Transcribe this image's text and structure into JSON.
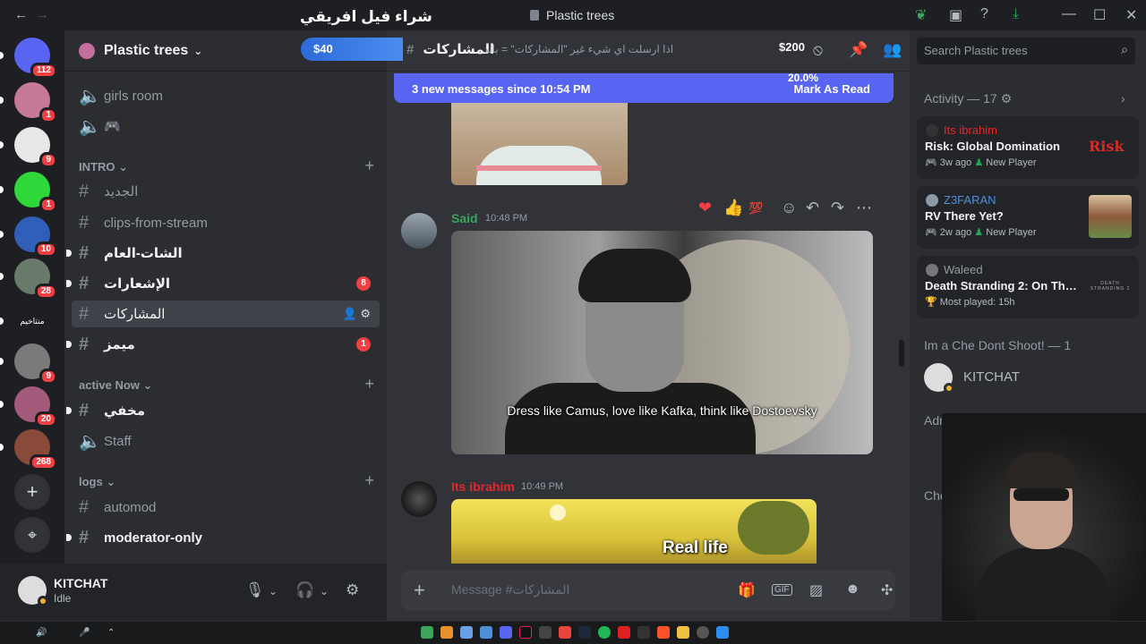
{
  "titlebar": {
    "back": "←",
    "forward": "→",
    "overlay_text": "شراء فيل افريقي",
    "window_title": "Plastic trees",
    "icons": [
      "leaf-icon",
      "screen-share-icon",
      "help-icon",
      "download-icon"
    ],
    "minimize": "—",
    "maximize": "☐",
    "close": "✕"
  },
  "servers": [
    {
      "label": "",
      "badge": "112",
      "color": "#5865f2"
    },
    {
      "label": "",
      "badge": "1",
      "color": "#c8799a"
    },
    {
      "label": "",
      "badge": "9",
      "color": "#e8e8e8"
    },
    {
      "label": "",
      "badge": "1",
      "color": "#2ed83a"
    },
    {
      "label": "",
      "badge": "10",
      "color": "#2f5fb8"
    },
    {
      "label": "",
      "badge": "28",
      "color": "#6a7a6a"
    },
    {
      "label": "منتاخيم",
      "badge": "",
      "color": "#1e1f22"
    },
    {
      "label": "",
      "badge": "9",
      "color": "#7a7a7a"
    },
    {
      "label": "",
      "badge": "20",
      "color": "#a45a7a"
    },
    {
      "label": "",
      "badge": "268",
      "color": "#8a4a3a"
    }
  ],
  "server_actions": {
    "add": "+",
    "discover": "⌖"
  },
  "guild": {
    "name": "Plastic trees",
    "chevron": "⌄"
  },
  "channels": {
    "voice": [
      {
        "name": "girls room"
      },
      {
        "name": "🎮"
      }
    ],
    "categories": [
      {
        "name": "INTRO"
      },
      {
        "name": "active Now"
      },
      {
        "name": "logs"
      }
    ],
    "intro": [
      {
        "name": "الجديد"
      },
      {
        "name": "clips-from-stream"
      },
      {
        "name": "الشات-العام"
      },
      {
        "name": "الإشعارات",
        "badge": "8"
      },
      {
        "name": "المشاركات"
      },
      {
        "name": "ميمز",
        "badge": "1"
      }
    ],
    "active_now": [
      {
        "name": "مخفي"
      },
      {
        "name": "Staff"
      }
    ],
    "logs": [
      {
        "name": "automod"
      },
      {
        "name": "moderator-only"
      }
    ]
  },
  "user": {
    "name": "KITCHAT",
    "status": "Idle"
  },
  "chat_header": {
    "money_left": "$40",
    "channel": "المشاركات",
    "topic": "اذا ارسلت اي شيء غير \"المشاركات\" = باند",
    "money_right": "$200"
  },
  "new_messages": {
    "text": "3 new messages since 10:54 PM",
    "mark": "Mark As Read",
    "percent": "20.0%"
  },
  "messages": [
    {
      "author": "Said",
      "time": "10:48 PM",
      "color": "#3ba55c",
      "caption": "Dress like Camus, love like Kafka, think like Dostoevsky"
    },
    {
      "author": "Its ibrahim",
      "time": "10:49 PM",
      "color": "#e0282e",
      "caption": "Real life"
    }
  ],
  "composer": {
    "placeholder": "Message #المشاركات",
    "plus": "+"
  },
  "search": {
    "placeholder": "Search Plastic trees"
  },
  "activity": {
    "header": "Activity — 17",
    "cards": [
      {
        "user": "Its ibrahim",
        "user_color": "#e0282e",
        "game": "Risk: Global Domination",
        "ago": "3w ago",
        "tag": "New Player",
        "art": "Risk"
      },
      {
        "user": "Z3FARAN",
        "user_color": "#4e8fd8",
        "game": "RV There Yet?",
        "ago": "2w ago",
        "tag": "New Player",
        "art": ""
      },
      {
        "user": "Waleed",
        "user_color": "#949ba4",
        "game": "Death Stranding 2: On The ...",
        "ago": "",
        "tag": "Most played: 15h",
        "art": "DEATH STRANDING 2"
      }
    ]
  },
  "member_groups": [
    {
      "name": "Im a Che Dont Shoot! — 1"
    },
    {
      "name": "Adr"
    },
    {
      "name": "Che"
    }
  ],
  "members": [
    {
      "name": "KITCHAT"
    }
  ]
}
